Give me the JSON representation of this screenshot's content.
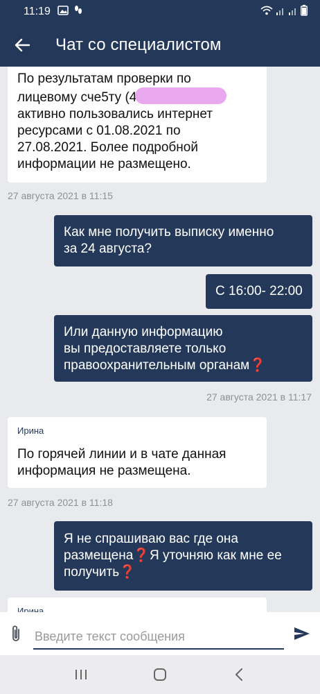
{
  "status_bar": {
    "time": "11:19",
    "icons": [
      "gallery-icon",
      "steps-icon",
      "wifi-icon",
      "signal-icon",
      "signal-icon",
      "battery-icon"
    ]
  },
  "app_bar": {
    "back_icon": "arrow-left-icon",
    "title": "Чат со специалистом"
  },
  "messages": [
    {
      "direction": "incoming",
      "lines": [
        "По результатам проверки по",
        "лицевому сче5ту (4",
        "активно пользовались интернет",
        "ресурсами с 01.08.2021 по",
        "27.08.2021. Более подробной",
        "информации не размещено."
      ],
      "timestamp": "27 августа 2021 в 11:15"
    },
    {
      "direction": "outgoing",
      "lines": [
        "Как мне получить выписку именно",
        "за 24 августа?"
      ]
    },
    {
      "direction": "outgoing",
      "lines": [
        "С 16:00- 22:00"
      ]
    },
    {
      "direction": "outgoing",
      "lines": [
        "Или данную информацию",
        "вы предоставляете только",
        "правоохранительным органам"
      ],
      "emoji": "❓",
      "timestamp": "27 августа 2021 в 11:17"
    },
    {
      "direction": "incoming",
      "author": "Ирина",
      "lines": [
        "По горячей линии и в чате данная",
        "информация не размещена."
      ],
      "timestamp": "27 августа 2021 в 11:18"
    },
    {
      "direction": "outgoing",
      "line1a": "Я не спрашиваю вас где она",
      "line2a": "размещена",
      "line2b": "Я уточняю как мне ее",
      "line3a": "получить",
      "emoji": "❓"
    },
    {
      "direction": "incoming",
      "author": "Ирина"
    }
  ],
  "input_bar": {
    "attach_icon": "paperclip-icon",
    "placeholder": "Введите текст сообщения",
    "value": "",
    "send_icon": "send-icon"
  },
  "nav_bar": {
    "icons": [
      "recent-apps-icon",
      "home-icon",
      "back-nav-icon"
    ]
  },
  "colors": {
    "primary": "#24385a",
    "background": "#e9eaed",
    "incoming_bubble": "#ffffff",
    "timestamp": "#8e9096",
    "redacted": "#e9a7ee",
    "question_mark": "#e53030"
  }
}
